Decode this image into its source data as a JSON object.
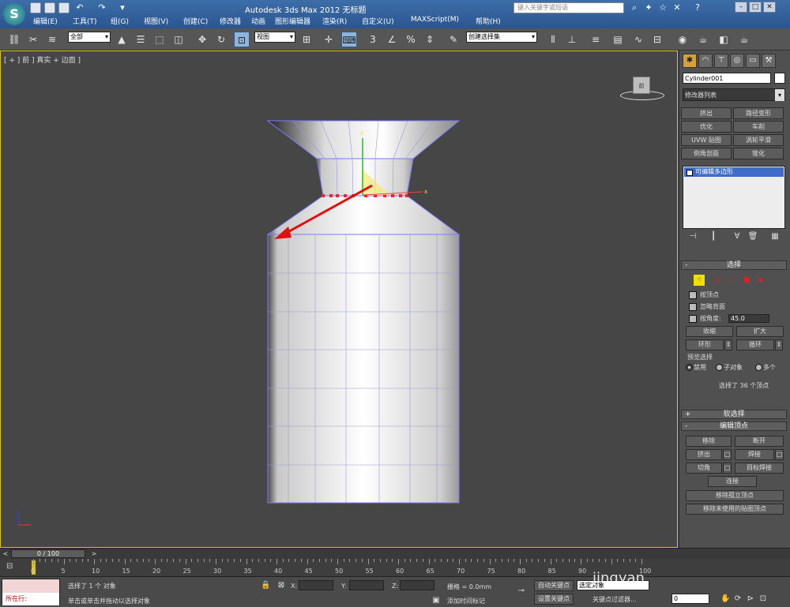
{
  "titlebar": {
    "app_logo": "S",
    "title": "Autodesk 3ds Max  2012      无标题",
    "search_placeholder": "键入关键字或短语",
    "menu": [
      "编辑(E)",
      "工具(T)",
      "组(G)",
      "视图(V)",
      "创建(C)",
      "修改器",
      "动画",
      "图形编辑器",
      "渲染(R)",
      "自定义(U)",
      "MAXScript(M)",
      "帮助(H)"
    ]
  },
  "toolbar": {
    "selection_filter": "全部",
    "ref_coord": "视图",
    "named_selection": "创建选择集"
  },
  "viewport": {
    "label": "[ + ] 前 ] 真实 + 边面 ]",
    "viewcube_label": "前"
  },
  "command_panel": {
    "object_name": "Cylinder001",
    "modifier_list": "修改器列表",
    "modifier_buttons": [
      "挤出",
      "路径变形",
      "优化",
      "车削",
      "UVW 贴图",
      "涡轮平滑",
      "倒角剖面",
      "锥化"
    ],
    "stack_item": "可编辑多边形",
    "selection_rollout": {
      "title": "选择",
      "by_vertex": "按顶点",
      "ignore_backfacing": "忽略背面",
      "by_angle": "按角度:",
      "angle_value": "45.0",
      "shrink": "收缩",
      "grow": "扩大",
      "ring": "环形",
      "loop": "循环",
      "preview_label": "预览选择",
      "preview_options": [
        "禁用",
        "子对象",
        "多个"
      ],
      "status": "选择了 36 个顶点"
    },
    "soft_selection": "软选择",
    "edit_vertices": {
      "title": "编辑顶点",
      "buttons": [
        "移除",
        "断开",
        "挤出",
        "焊接",
        "切角",
        "目标焊接",
        "连接",
        "移除孤立顶点",
        "移除未使用的贴图顶点"
      ]
    }
  },
  "timeline": {
    "frame_readout": "0 / 100",
    "ruler_labels": [
      "0",
      "5",
      "10",
      "15",
      "20",
      "25",
      "30",
      "35",
      "40",
      "45",
      "50",
      "55",
      "60",
      "65",
      "70",
      "75",
      "80",
      "85",
      "90",
      "100"
    ]
  },
  "statusbar": {
    "maxscript": "所在行:",
    "status_line1": "选择了 1 个 对象",
    "status_line2": "单击或单击并拖动以选择对象",
    "x_label": "X:",
    "y_label": "Y:",
    "z_label": "Z:",
    "grid": "栅格 = 0.0mm",
    "add_time_tag": "添加时间标记",
    "auto_key": "自动关键点",
    "set_key": "设置关键点",
    "selected_object": "选定对象",
    "key_filters": "关键点过滤器...",
    "frame_value": "0",
    "watermark": "jingyan"
  }
}
